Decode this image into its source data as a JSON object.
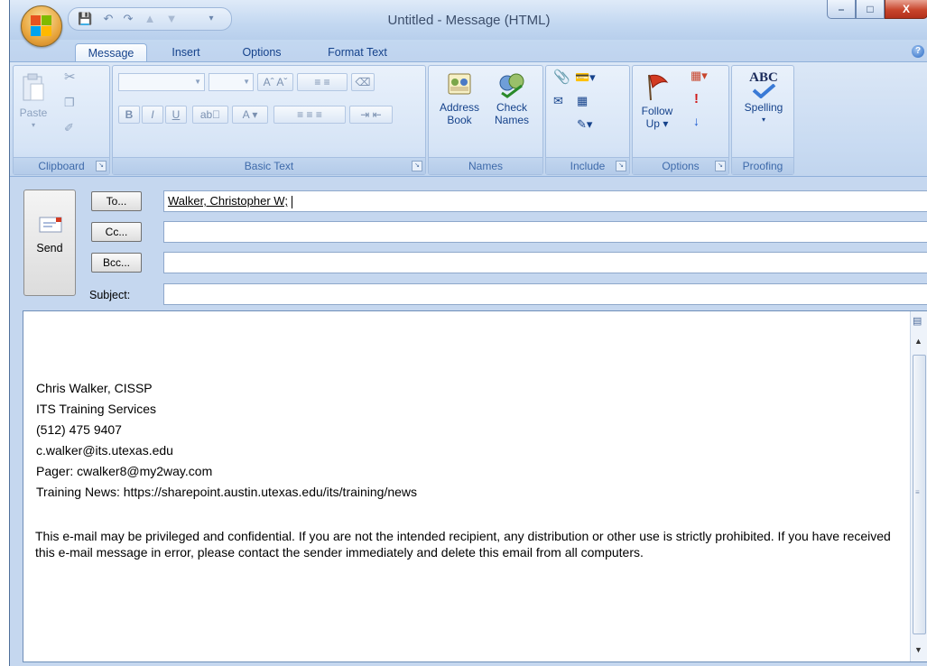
{
  "window": {
    "title": "Untitled - Message (HTML)",
    "controls": [
      "minimize",
      "maximize",
      "close"
    ]
  },
  "quick_access": [
    "save",
    "undo",
    "redo",
    "previous-item",
    "next-item",
    "customize"
  ],
  "tabs": [
    {
      "label": "Message",
      "active": true
    },
    {
      "label": "Insert",
      "active": false
    },
    {
      "label": "Options",
      "active": false
    },
    {
      "label": "Format Text",
      "active": false
    }
  ],
  "ribbon": {
    "clipboard": {
      "group_label": "Clipboard",
      "paste_label": "Paste"
    },
    "basic_text": {
      "group_label": "Basic Text",
      "bold": "B",
      "italic": "I",
      "underline": "U"
    },
    "names": {
      "group_label": "Names",
      "address_book": "Address Book",
      "address_line1": "Address",
      "address_line2": "Book",
      "check_names": "Check Names",
      "check_line1": "Check",
      "check_line2": "Names"
    },
    "include": {
      "group_label": "Include"
    },
    "options": {
      "group_label": "Options",
      "follow_up": "Follow Up",
      "follow_line1": "Follow",
      "follow_line2": "Up"
    },
    "proofing": {
      "group_label": "Proofing",
      "spelling": "Spelling",
      "abc": "ABC"
    }
  },
  "form": {
    "send_label": "Send",
    "to_button": "To...",
    "cc_button": "Cc...",
    "bcc_button": "Bcc...",
    "subject_label": "Subject:",
    "to_value": "Walker, Christopher W;",
    "cc_value": "",
    "bcc_value": "",
    "subject_value": ""
  },
  "body": {
    "signature": [
      "Chris Walker, CISSP",
      "ITS Training Services",
      "(512) 475 9407",
      "c.walker@its.utexas.edu",
      "Pager:  cwalker8@my2way.com",
      "Training News:  https://sharepoint.austin.utexas.edu/its/training/news"
    ],
    "disclaimer": "This e-mail may be privileged and confidential.  If you are not the intended recipient, any distribution or other use is strictly prohibited.   If you have received this e-mail message in error, please contact the sender immediately and delete this email from all computers."
  },
  "colors": {
    "ribbon_text": "#15428b",
    "title_text": "#3c4e6b",
    "window_bg": "#c5d7ef",
    "close_button": "#c8452c"
  }
}
